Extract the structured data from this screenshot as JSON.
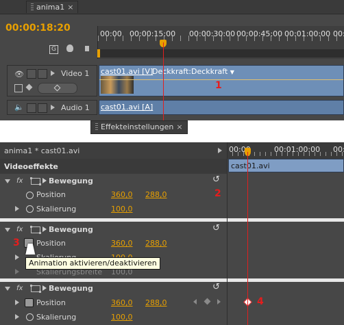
{
  "timeline": {
    "tab": "anima1",
    "close": "×",
    "timecode": "00:00:18:20",
    "ruler": [
      "00:00",
      "00:00:15:00",
      "00:00:30:00",
      "00:00:45:00",
      "00:01:00:00",
      "00:"
    ],
    "video_track": "Video 1",
    "audio_track": "Audio 1",
    "video_clip": "cast01.avi [V]",
    "video_clip_fx": "Deckkraft:Deckkraft",
    "audio_clip": "cast01.avi [A]",
    "marker1": "1"
  },
  "effects": {
    "tab": "Effekteinstellungen",
    "close": "×",
    "source": "anima1 * cast01.avi",
    "ruler": [
      "00:00",
      "00:01:00:00",
      "00:"
    ],
    "section": "Videoeffekte",
    "clip": "cast01.avi",
    "fx_label": "fx",
    "block1": {
      "effect": "Bewegung",
      "position": {
        "label": "Position",
        "x": "360,0",
        "y": "288,0"
      },
      "scale": {
        "label": "Skalierung",
        "value": "100,0"
      },
      "marker": "2"
    },
    "block2": {
      "effect": "Bewegung",
      "position": {
        "label": "Position",
        "x": "360,0",
        "y": "288,0"
      },
      "scale": {
        "label": "Skalierung",
        "value": "100,0"
      },
      "scale_width": {
        "label": "Skalierungsbreite",
        "value": "100,0"
      },
      "marker": "3",
      "tooltip": "Animation aktivieren/deaktivieren"
    },
    "block3": {
      "effect": "Bewegung",
      "position": {
        "label": "Position",
        "x": "360,0",
        "y": "288,0"
      },
      "scale": {
        "label": "Skalierung",
        "value": "100,0"
      },
      "marker": "4"
    }
  },
  "colors": {
    "accent": "#e8a000",
    "marker_red": "#e51d1d",
    "clip_blue": "#6e8fb7",
    "panel": "#474747"
  }
}
